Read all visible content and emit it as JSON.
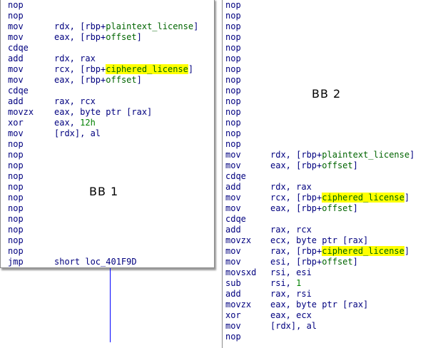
{
  "bb1": {
    "label": "BB 1",
    "lines": [
      {
        "m": "nop"
      },
      {
        "m": "nop"
      },
      {
        "m": "mov",
        "o": [
          {
            "t": "rdx, ["
          },
          {
            "t": "rbp"
          },
          {
            "t": "+"
          },
          {
            "t": "plaintext_license",
            "k": "sym"
          },
          {
            "t": "]"
          }
        ]
      },
      {
        "m": "mov",
        "o": [
          {
            "t": "eax, ["
          },
          {
            "t": "rbp"
          },
          {
            "t": "+"
          },
          {
            "t": "offset",
            "k": "sym"
          },
          {
            "t": "]"
          }
        ]
      },
      {
        "m": "cdqe"
      },
      {
        "m": "add",
        "o": [
          {
            "t": "rdx, rax"
          }
        ]
      },
      {
        "m": "mov",
        "o": [
          {
            "t": "rcx, ["
          },
          {
            "t": "rbp"
          },
          {
            "t": "+"
          },
          {
            "t": "ciphered_license",
            "k": "hl"
          },
          {
            "t": "]"
          }
        ]
      },
      {
        "m": "mov",
        "o": [
          {
            "t": "eax, ["
          },
          {
            "t": "rbp"
          },
          {
            "t": "+"
          },
          {
            "t": "offset",
            "k": "sym"
          },
          {
            "t": "]"
          }
        ]
      },
      {
        "m": "cdqe"
      },
      {
        "m": "add",
        "o": [
          {
            "t": "rax, rcx"
          }
        ]
      },
      {
        "m": "movzx",
        "o": [
          {
            "t": "eax, byte ptr [rax]"
          }
        ]
      },
      {
        "m": "xor",
        "o": [
          {
            "t": "eax, "
          },
          {
            "t": "12h",
            "k": "num"
          }
        ]
      },
      {
        "m": "mov",
        "o": [
          {
            "t": "[rdx], al"
          }
        ]
      },
      {
        "m": "nop"
      },
      {
        "m": "nop"
      },
      {
        "m": "nop"
      },
      {
        "m": "nop"
      },
      {
        "m": "nop"
      },
      {
        "m": "nop"
      },
      {
        "m": "nop"
      },
      {
        "m": "nop"
      },
      {
        "m": "nop"
      },
      {
        "m": "nop"
      },
      {
        "m": "nop"
      },
      {
        "m": "jmp",
        "o": [
          {
            "t": "short loc_401F9D"
          }
        ]
      }
    ]
  },
  "bb2": {
    "label": "BB 2",
    "lines": [
      {
        "m": "nop"
      },
      {
        "m": "nop"
      },
      {
        "m": "nop"
      },
      {
        "m": "nop"
      },
      {
        "m": "nop"
      },
      {
        "m": "nop"
      },
      {
        "m": "nop"
      },
      {
        "m": "nop"
      },
      {
        "m": "nop"
      },
      {
        "m": "nop"
      },
      {
        "m": "nop"
      },
      {
        "m": "nop"
      },
      {
        "m": "nop"
      },
      {
        "m": "nop"
      },
      {
        "m": "mov",
        "o": [
          {
            "t": "rdx, ["
          },
          {
            "t": "rbp"
          },
          {
            "t": "+"
          },
          {
            "t": "plaintext_license",
            "k": "sym"
          },
          {
            "t": "]"
          }
        ]
      },
      {
        "m": "mov",
        "o": [
          {
            "t": "eax, ["
          },
          {
            "t": "rbp"
          },
          {
            "t": "+"
          },
          {
            "t": "offset",
            "k": "sym"
          },
          {
            "t": "]"
          }
        ]
      },
      {
        "m": "cdqe"
      },
      {
        "m": "add",
        "o": [
          {
            "t": "rdx, rax"
          }
        ]
      },
      {
        "m": "mov",
        "o": [
          {
            "t": "rcx, ["
          },
          {
            "t": "rbp"
          },
          {
            "t": "+"
          },
          {
            "t": "ciphered_license",
            "k": "hl"
          },
          {
            "t": "]"
          }
        ]
      },
      {
        "m": "mov",
        "o": [
          {
            "t": "eax, ["
          },
          {
            "t": "rbp"
          },
          {
            "t": "+"
          },
          {
            "t": "offset",
            "k": "sym"
          },
          {
            "t": "]"
          }
        ]
      },
      {
        "m": "cdqe"
      },
      {
        "m": "add",
        "o": [
          {
            "t": "rax, rcx"
          }
        ]
      },
      {
        "m": "movzx",
        "o": [
          {
            "t": "ecx, byte ptr [rax]"
          }
        ]
      },
      {
        "m": "mov",
        "o": [
          {
            "t": "rax, ["
          },
          {
            "t": "rbp"
          },
          {
            "t": "+"
          },
          {
            "t": "ciphered_license",
            "k": "hl"
          },
          {
            "t": "]"
          }
        ]
      },
      {
        "m": "mov",
        "o": [
          {
            "t": "esi, ["
          },
          {
            "t": "rbp"
          },
          {
            "t": "+"
          },
          {
            "t": "offset",
            "k": "sym"
          },
          {
            "t": "]"
          }
        ]
      },
      {
        "m": "movsxd",
        "o": [
          {
            "t": "rsi, esi"
          }
        ]
      },
      {
        "m": "sub",
        "o": [
          {
            "t": "rsi, "
          },
          {
            "t": "1",
            "k": "num"
          }
        ]
      },
      {
        "m": "add",
        "o": [
          {
            "t": "rax, rsi"
          }
        ]
      },
      {
        "m": "movzx",
        "o": [
          {
            "t": "eax, byte ptr [rax]"
          }
        ]
      },
      {
        "m": "xor",
        "o": [
          {
            "t": "eax, ecx"
          }
        ]
      },
      {
        "m": "mov",
        "o": [
          {
            "t": "[rdx], al"
          }
        ]
      },
      {
        "m": "nop"
      }
    ]
  },
  "colors": {
    "mnemonic": "#00007f",
    "symbol": "#006400",
    "highlight": "#ffff00",
    "number": "#008000",
    "edge": "#0000ff"
  }
}
